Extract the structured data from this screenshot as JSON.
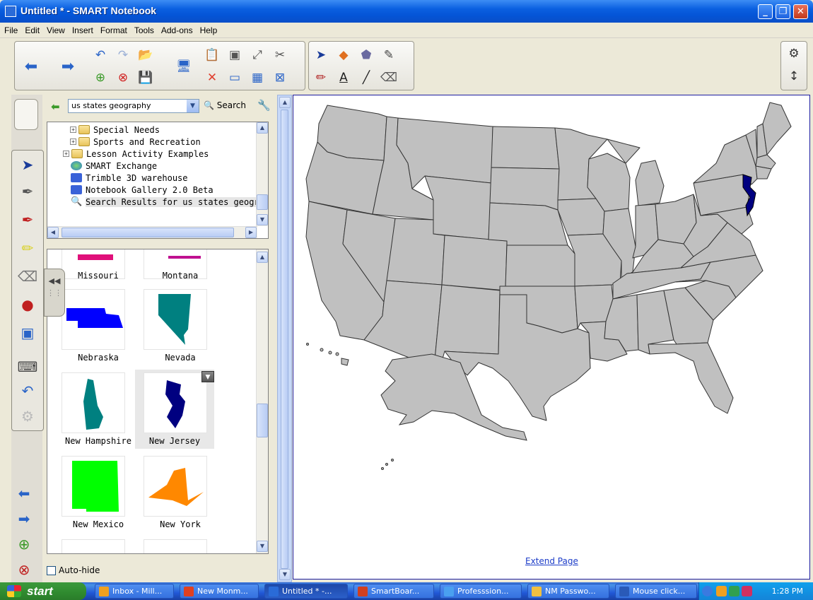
{
  "window": {
    "title": "Untitled * - SMART Notebook"
  },
  "menu": [
    "File",
    "Edit",
    "View",
    "Insert",
    "Format",
    "Tools",
    "Add-ons",
    "Help"
  ],
  "gallery": {
    "search_value": "us states geography",
    "search_label": "Search",
    "tree": [
      {
        "label": "Special Needs",
        "type": "folder",
        "indent": 1
      },
      {
        "label": "Sports and Recreation",
        "type": "folder",
        "indent": 1
      },
      {
        "label": "Lesson Activity Examples",
        "type": "folder",
        "indent": 0
      },
      {
        "label": "SMART Exchange",
        "type": "globe",
        "indent": 0
      },
      {
        "label": "Trimble 3D warehouse",
        "type": "link",
        "indent": 0
      },
      {
        "label": "Notebook Gallery 2.0 Beta",
        "type": "link",
        "indent": 0
      },
      {
        "label": "Search Results for us states geograph",
        "type": "search",
        "indent": 0
      }
    ],
    "thumbnails": [
      {
        "label": "Missouri",
        "color": "#e0107a"
      },
      {
        "label": "Montana",
        "color": "#c01090"
      },
      {
        "label": "Nebraska",
        "color": "#0000ff"
      },
      {
        "label": "Nevada",
        "color": "#008080"
      },
      {
        "label": "New Hampshire",
        "color": "#008080"
      },
      {
        "label": "New Jersey",
        "color": "#000080"
      },
      {
        "label": "New Mexico",
        "color": "#00ff00"
      },
      {
        "label": "New York",
        "color": "#ff8800"
      }
    ],
    "autohide_label": "Auto-hide"
  },
  "canvas": {
    "extend_label": "Extend Page",
    "map_fill": "#c0c0c0",
    "highlight_fill": "#000080"
  },
  "taskbar": {
    "start_label": "start",
    "items": [
      {
        "label": "Inbox - Mill...",
        "icon_color": "#f0a020",
        "active": false
      },
      {
        "label": "New Monm...",
        "icon_color": "#e04020",
        "active": false
      },
      {
        "label": "Untitled * -...",
        "icon_color": "#2a6bd8",
        "active": true
      },
      {
        "label": "SmartBoar...",
        "icon_color": "#d04020",
        "active": false
      },
      {
        "label": "Professsion...",
        "icon_color": "#4aa0f0",
        "active": false
      },
      {
        "label": "NM Passwo...",
        "icon_color": "#f0c040",
        "active": false
      },
      {
        "label": "Mouse click...",
        "icon_color": "#2a5ab8",
        "active": false
      }
    ],
    "clock": "1:28 PM"
  }
}
